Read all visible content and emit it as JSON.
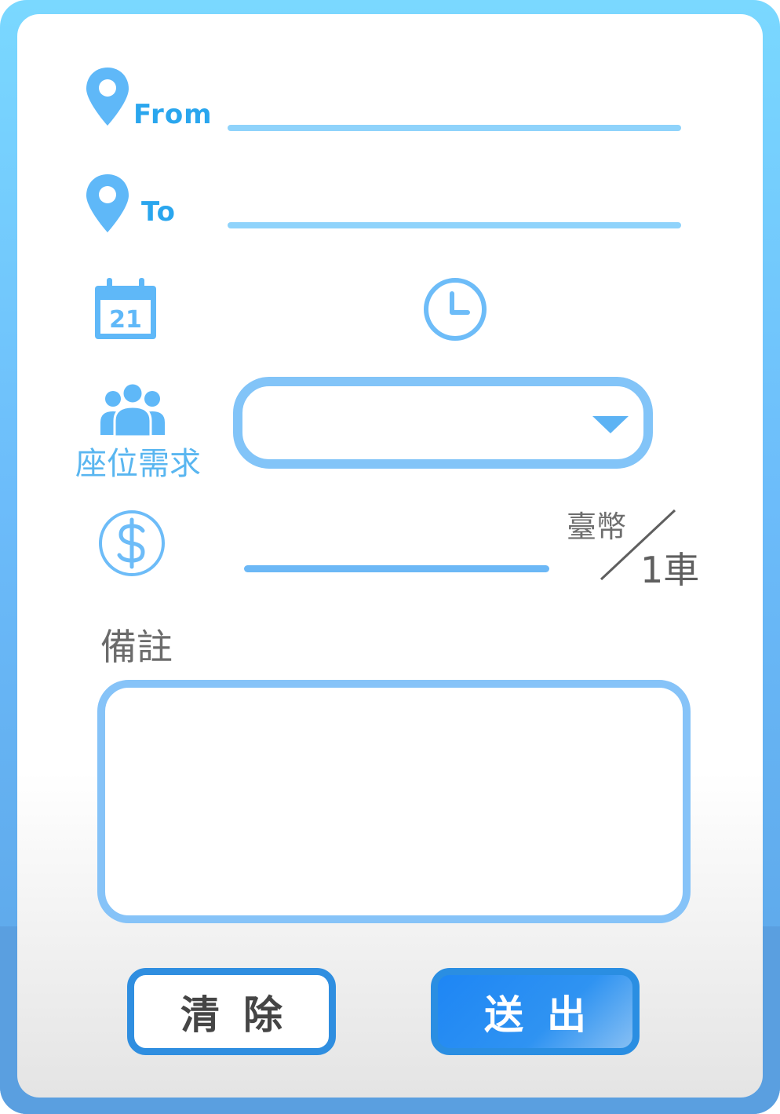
{
  "from": {
    "label": "From",
    "icon": "map-pin-icon",
    "value": ""
  },
  "to": {
    "label": "To",
    "icon": "map-pin-icon",
    "value": ""
  },
  "date": {
    "icon": "calendar-icon",
    "day_number": "21"
  },
  "time": {
    "icon": "clock-icon"
  },
  "seats": {
    "label": "座位需求",
    "icon": "people-icon",
    "selected": ""
  },
  "price": {
    "icon": "dollar-icon",
    "value": "",
    "currency": "臺幣",
    "per": "1車"
  },
  "notes": {
    "label": "備註",
    "value": ""
  },
  "buttons": {
    "clear": "清除",
    "submit": "送出"
  },
  "colors": {
    "accent": "#6cbcfa",
    "line": "#8fd3fb",
    "submit": "#1e86f4"
  }
}
